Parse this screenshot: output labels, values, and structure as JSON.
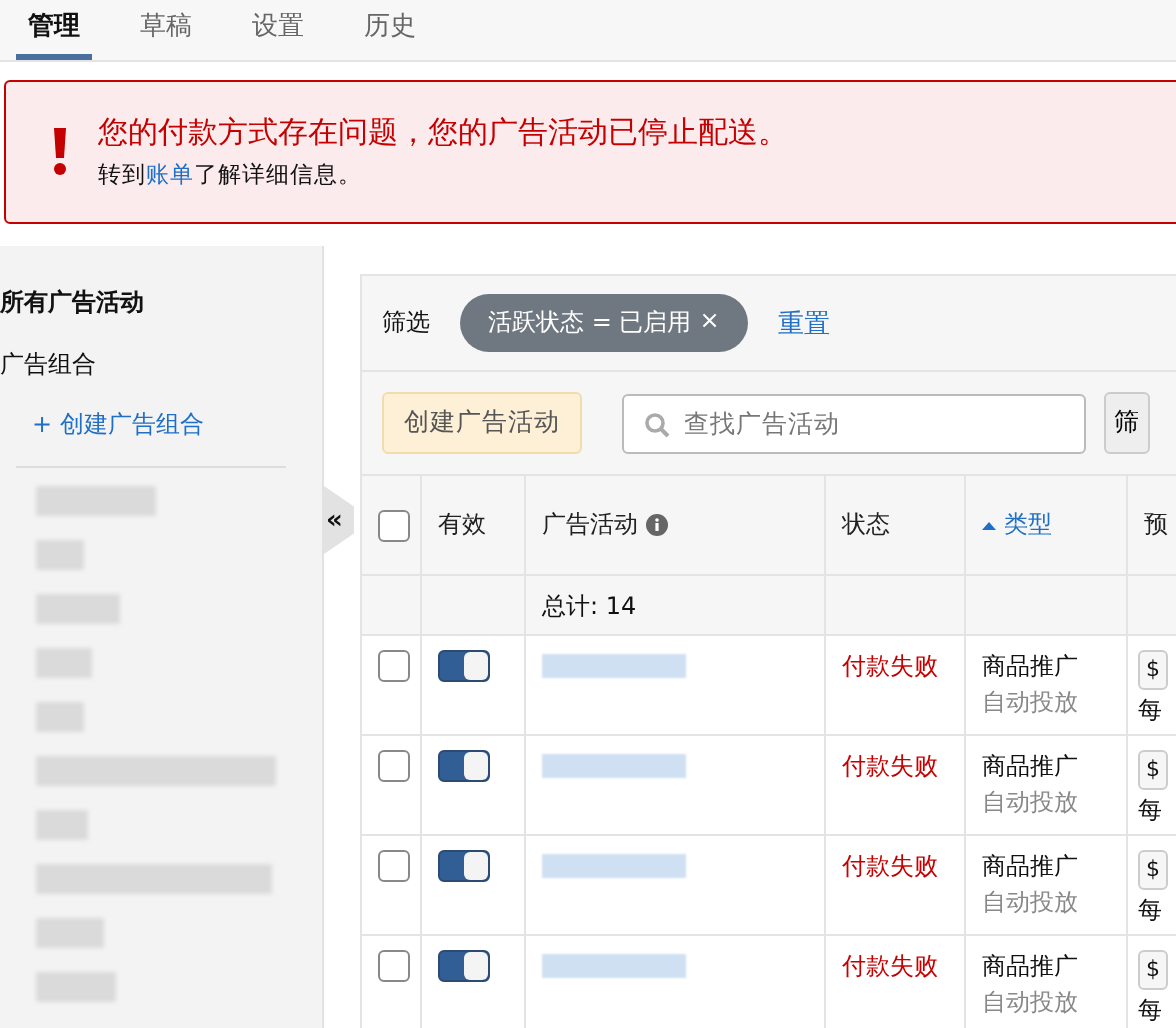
{
  "tabs": [
    {
      "label": "管理",
      "selected": true
    },
    {
      "label": "草稿",
      "selected": false
    },
    {
      "label": "设置",
      "selected": false
    },
    {
      "label": "历史",
      "selected": false
    }
  ],
  "alert": {
    "message": "您的付款方式存在问题，您的广告活动已停止配送。",
    "detail_before": "转到",
    "link": "账单",
    "detail_after": "了解详细信息。"
  },
  "sidebar": {
    "title": "所有广告活动",
    "group_heading": "广告组合",
    "create_link": "+ 创建广告组合",
    "collapse_glyph": "«"
  },
  "filter": {
    "label": "筛选",
    "chip": "活跃状态 = 已启用",
    "chip_close": "×",
    "reset": "重置"
  },
  "toolbar": {
    "create_button": "创建广告活动",
    "search_placeholder": "查找广告活动",
    "filter_button": "筛"
  },
  "table": {
    "select_all_checked": false,
    "columns": [
      {
        "label": "有效",
        "kind": "plain"
      },
      {
        "label": "广告活动",
        "kind": "info"
      },
      {
        "label": "状态",
        "kind": "plain"
      },
      {
        "label": "类型",
        "kind": "sorted"
      },
      {
        "label": "预",
        "kind": "plain"
      }
    ],
    "total": "总计: 14",
    "rows": [
      {
        "checked": false,
        "enabled": true,
        "status": "付款失败",
        "type": "商品推广",
        "targeting": "自动投放",
        "budget_currency": "$",
        "budget_period": "每"
      },
      {
        "checked": false,
        "enabled": true,
        "status": "付款失败",
        "type": "商品推广",
        "targeting": "自动投放",
        "budget_currency": "$",
        "budget_period": "每"
      },
      {
        "checked": false,
        "enabled": true,
        "status": "付款失败",
        "type": "商品推广",
        "targeting": "自动投放",
        "budget_currency": "$",
        "budget_period": "每"
      },
      {
        "checked": false,
        "enabled": true,
        "status": "付款失败",
        "type": "商品推广",
        "targeting": "自动投放",
        "budget_currency": "$",
        "budget_period": "每"
      }
    ]
  }
}
